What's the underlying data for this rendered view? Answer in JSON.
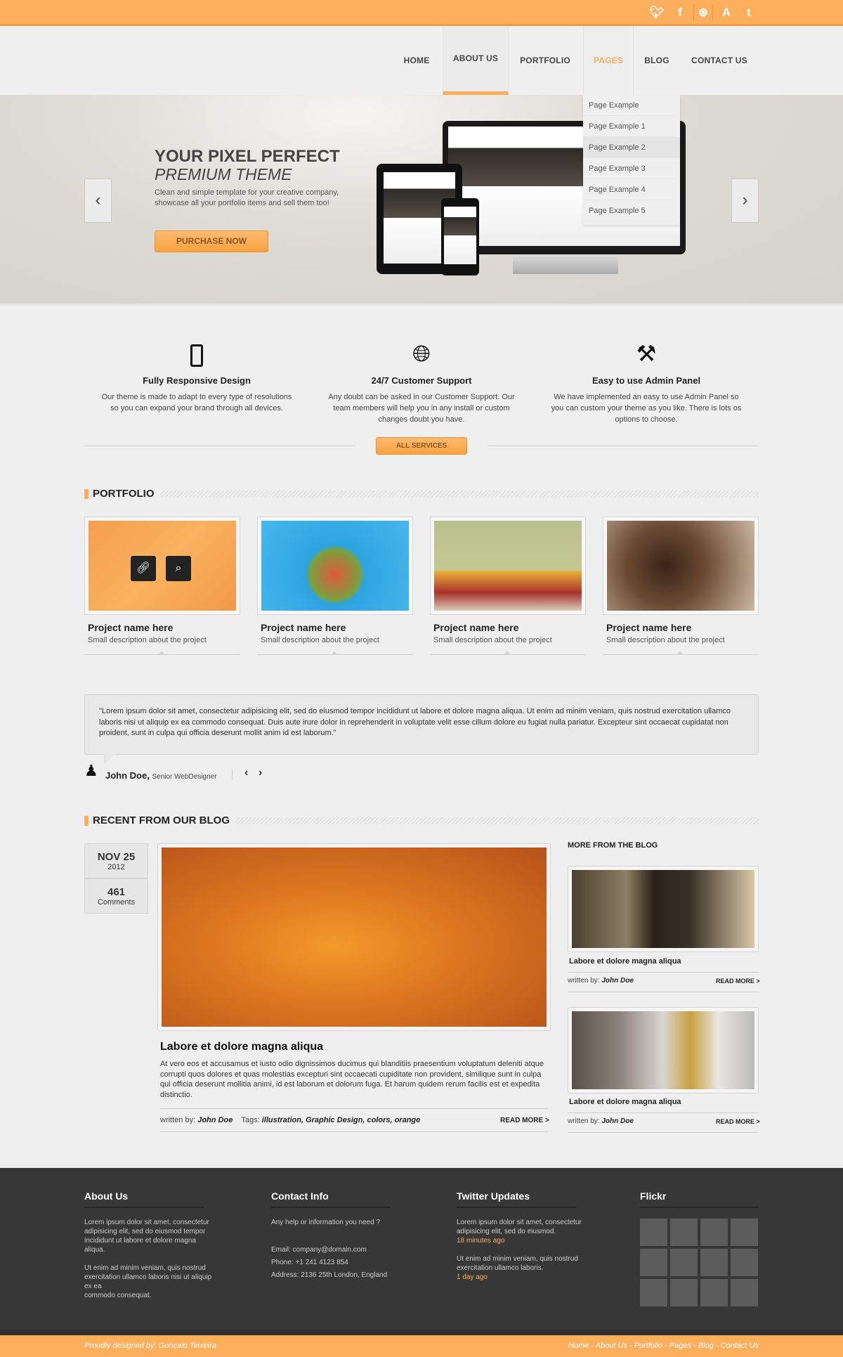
{
  "colors": {
    "accent": "#fbae5c",
    "footer": "#373737"
  },
  "social": [
    "twitter-icon",
    "facebook-icon",
    "dribbble-icon",
    "app-icon",
    "tumblr-icon"
  ],
  "nav": {
    "items": [
      "HOME",
      "ABOUT US",
      "PORTFOLIO",
      "PAGES",
      "BLOG",
      "CONTACT US"
    ],
    "active": "ABOUT US",
    "hover": "PAGES"
  },
  "dropdown": [
    "Page Example",
    "Page Example 1",
    "Page Example 2",
    "Page Example 3",
    "Page Example 4",
    "Page Example 5"
  ],
  "hero": {
    "title": "YOUR PIXEL PERFECT",
    "subtitle": "PREMIUM THEME",
    "text": "Clean and simple template for your creative company, showcase all your portfolio items and sell them too!",
    "button": "PURCHASE NOW"
  },
  "features": [
    {
      "icon": "smartphone-icon",
      "title": "Fully Responsive Design",
      "text": "Our theme is made to adapt to every type of resolutions so you can expand your brand through all devices."
    },
    {
      "icon": "globe-icon",
      "title": "24/7 Customer Support",
      "text": "Any doubt can be asked in our Customer Support. Our team members will help you in any install or custom changes doubt you have."
    },
    {
      "icon": "tools-icon",
      "title": "Easy to use Admin Panel",
      "text": "We have implemented an easy to use Admin Panel so you can custom your theme as you like. There is lots os options to choose."
    }
  ],
  "all_services": "ALL SERVICES",
  "portfolio": {
    "heading": "PORTFOLIO",
    "items": [
      {
        "name": "Project name here",
        "desc": "Small description about the project"
      },
      {
        "name": "Project name here",
        "desc": "Small description about the project"
      },
      {
        "name": "Project name here",
        "desc": "Small description about the project"
      },
      {
        "name": "Project name here",
        "desc": "Small description about the project"
      }
    ]
  },
  "testimonial": {
    "quote": "\"Lorem ipsum dolor sit amet, consectetur adipisicing elit, sed do eiusmod tempor incididunt ut labore et dolore magna aliqua. Ut enim ad minim veniam, quis nostrud exercitation ullamco laboris nisi ut aliquip ex ea commodo consequat. Duis aute irure dolor in reprehenderit in voluptate velit esse cillum dolore eu fugiat nulla pariatur. Excepteur sint occaecat cupidatat non proident, sunt in culpa qui officia deserunt mollit anim id est laborum.\"",
    "author": "John Doe,",
    "role": "Senior WebDesigner"
  },
  "blog": {
    "heading": "RECENT FROM OUR BLOG",
    "date": "NOV 25",
    "year": "2012",
    "comments": "461",
    "comments_label": "Comments",
    "post": {
      "title": "Labore et dolore magna aliqua",
      "text": "At vero eos et accusamus et iusto odio dignissimos ducimus qui blanditiis praesentium voluptatum deleniti atque corrupti quos dolores et quas molestias excepturi sint occaecati cupiditate non provident, similique sunt in culpa qui officia deserunt mollitia animi, id est laborum et dolorum fuga. Et harum quidem rerum facilis est et expedita distinctio.",
      "written_by": "written by:",
      "author": "John Doe",
      "tags_label": "Tags:",
      "tags": "illustration, Graphic Design, colors, orange",
      "read_more": "READ MORE >"
    },
    "more_heading": "MORE FROM THE BLOG",
    "more": [
      {
        "title": "Labore et dolore magna aliqua",
        "written_by": "written by:",
        "author": "John Doe",
        "read_more": "READ MORE >"
      },
      {
        "title": "Labore et dolore magna aliqua",
        "written_by": "written by:",
        "author": "John Doe",
        "read_more": "READ MORE >"
      }
    ]
  },
  "footer": {
    "about": {
      "title": "About Us",
      "p1": "Lorem ipsum dolor sit amet, consectetur adipisicing elit, sed do eiusmod tempor incididunt ut labore et dolore magna aliqua.",
      "p2": "Ut enim ad minim veniam, quis nostrud exercitation ullamco laboris nisi ut aliquip ex ea",
      "p3": "commodo consequat."
    },
    "contact": {
      "title": "Contact Info",
      "intro": "Any help or information you need ?",
      "email": "Email: company@domain.com",
      "phone": "Phone: +1 241 4123 854",
      "address": "Address: 2136 25th London, England"
    },
    "twitter": {
      "title": "Twitter Updates",
      "t1": "Lorem ipsum dolor sit amet, consectetur adipisicing elit, sed do eiusmod.",
      "t1_time": "18 minutes ago",
      "t2": "Ut enim ad minim veniam, quis nostrud exercitation ullamco laboris.",
      "t2_time": "1 day ago"
    },
    "flickr": {
      "title": "Flickr"
    },
    "credit": "Proudly designed by: Gonçalo Teixeira",
    "links": [
      "Home",
      "About Us",
      "Portfolio",
      "Pages",
      "Blog",
      "Contact Us"
    ]
  }
}
